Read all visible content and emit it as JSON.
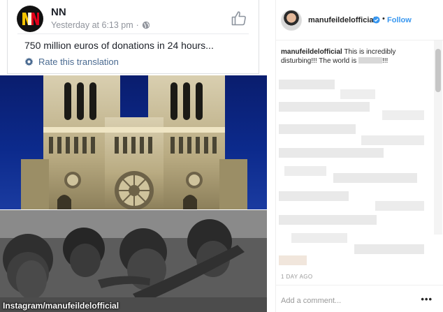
{
  "facebook_post": {
    "page_name": "NN",
    "timestamp": "Yesterday at 6:13 pm",
    "separator": "·",
    "text": "750 million euros of donations in 24 hours...",
    "translate_label": "Rate this translation"
  },
  "photos": {
    "caption": "Instagram/manufeildelofficial"
  },
  "instagram": {
    "username": "manufeildelofficial",
    "separator": "•",
    "follow_label": "Follow",
    "caption_user": "manufeildelofficial",
    "caption_text": "This is incredibly disturbing!!! The world is",
    "caption_end": "!!!",
    "time_ago": "1 DAY AGO",
    "comment_placeholder": "Add a comment...",
    "more_label": "•••"
  },
  "colors": {
    "facebook_link": "#4b6b91",
    "instagram_blue": "#3897f0",
    "sky": "#0c2a8c"
  }
}
